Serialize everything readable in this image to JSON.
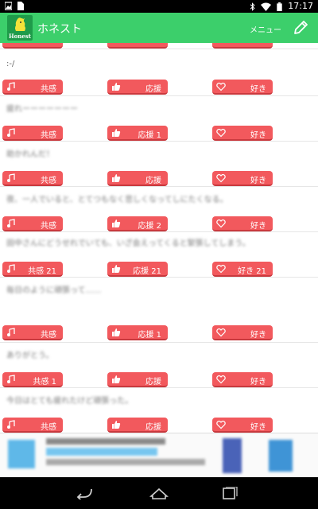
{
  "status_bar": {
    "time": "17:17",
    "icons_left": [
      "image-icon",
      "sim-icon"
    ],
    "icons_right": [
      "bluetooth-icon",
      "wifi-icon",
      "battery-icon"
    ]
  },
  "app_bar": {
    "logo_text": "Honest",
    "title": "ホネスト",
    "menu_label": "メニュー",
    "compose_icon": "pencil-icon",
    "color": "#3ccf6b"
  },
  "buttons": {
    "color": "#f2595d",
    "empathy_icon": "music-note-icon",
    "support_icon": "thumbs-up-icon",
    "like_icon": "heart-icon"
  },
  "posts": [
    {
      "text": ":-/",
      "blurred": false,
      "empathy": "共感",
      "support": "応援",
      "like": "好き"
    },
    {
      "text": "疲れーーーーーーー",
      "blurred": true,
      "empathy": "共感",
      "support": "応援 1",
      "like": "好き"
    },
    {
      "text": "助かれんだ！",
      "blurred": true,
      "empathy": "共感",
      "support": "応援",
      "like": "好き"
    },
    {
      "text": "夜、一人でいると、とてつもなく悲しくなってしにたくなる。",
      "blurred": true,
      "empathy": "共感",
      "support": "応援 2",
      "like": "好き"
    },
    {
      "text": "田中さんにどうせれでいても、いざ会えってくると緊張してしまう。",
      "blurred": true,
      "empathy": "共感 21",
      "support": "応援 21",
      "like": "好き 21"
    },
    {
      "text": "毎日のように頑張って……",
      "blurred": true,
      "empathy": "共感",
      "support": "応援 1",
      "like": "好き"
    },
    {
      "text": "ありがとう。",
      "blurred": true,
      "empathy": "共感 1",
      "support": "応援",
      "like": "好き"
    },
    {
      "text": "今日はとても疲れたけど頑張った。",
      "blurred": true,
      "empathy": "共感",
      "support": "応援",
      "like": "好き"
    }
  ],
  "navbar": {
    "icons": [
      "back-icon",
      "home-icon",
      "recents-icon"
    ]
  }
}
